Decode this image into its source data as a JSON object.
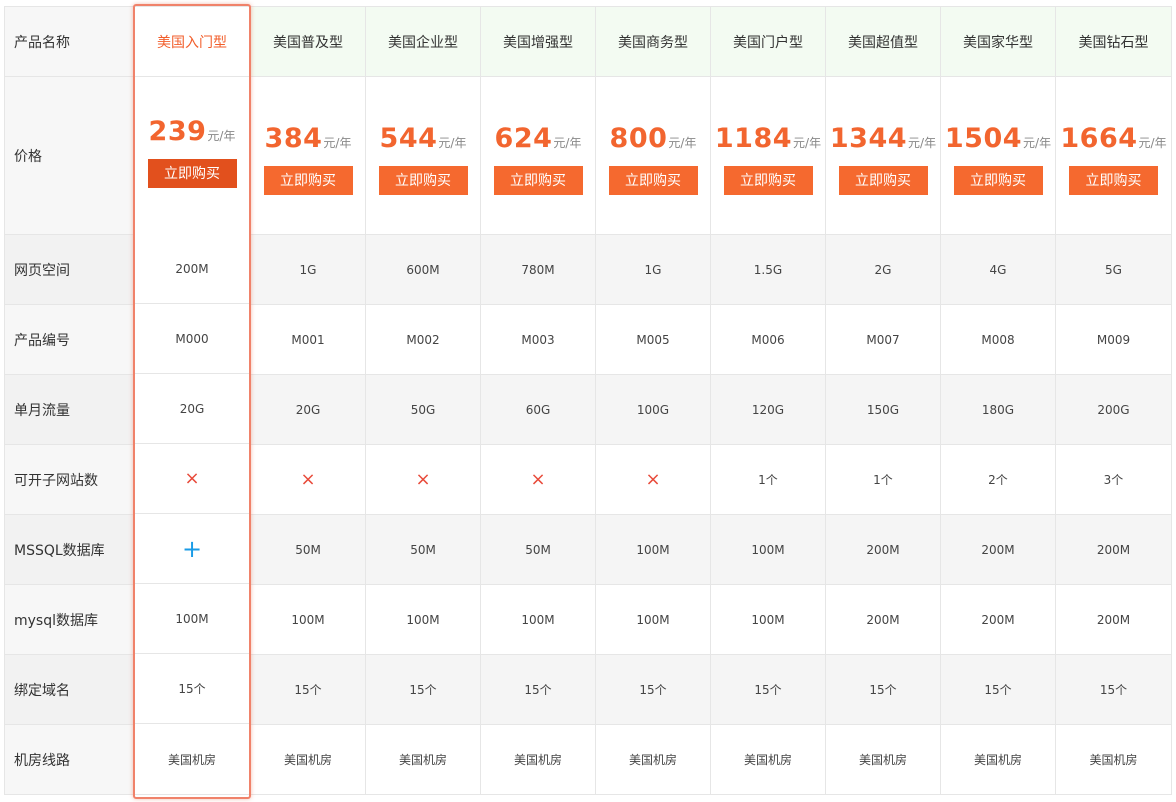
{
  "header": {
    "label": "产品名称",
    "plans": [
      "美国入门型",
      "美国普及型",
      "美国企业型",
      "美国增强型",
      "美国商务型",
      "美国门户型",
      "美国超值型",
      "美国家华型",
      "美国钻石型"
    ]
  },
  "price": {
    "label": "价格",
    "unit": "元/年",
    "buy_label": "立即购买",
    "values": [
      "239",
      "384",
      "544",
      "624",
      "800",
      "1184",
      "1344",
      "1504",
      "1664"
    ]
  },
  "rows": [
    {
      "label": "网页空间",
      "values": [
        "200M",
        "1G",
        "600M",
        "780M",
        "1G",
        "1.5G",
        "2G",
        "4G",
        "5G"
      ]
    },
    {
      "label": "产品编号",
      "values": [
        "M000",
        "M001",
        "M002",
        "M003",
        "M005",
        "M006",
        "M007",
        "M008",
        "M009"
      ]
    },
    {
      "label": "单月流量",
      "values": [
        "20G",
        "20G",
        "50G",
        "60G",
        "100G",
        "120G",
        "150G",
        "180G",
        "200G"
      ]
    },
    {
      "label": "可开子网站数",
      "values": [
        "×",
        "×",
        "×",
        "×",
        "×",
        "1个",
        "1个",
        "2个",
        "3个"
      ]
    },
    {
      "label": "MSSQL数据库",
      "values": [
        "+",
        "50M",
        "50M",
        "50M",
        "100M",
        "100M",
        "200M",
        "200M",
        "200M"
      ]
    },
    {
      "label": "mysql数据库",
      "values": [
        "100M",
        "100M",
        "100M",
        "100M",
        "100M",
        "100M",
        "200M",
        "200M",
        "200M"
      ]
    },
    {
      "label": "绑定域名",
      "values": [
        "15个",
        "15个",
        "15个",
        "15个",
        "15个",
        "15个",
        "15个",
        "15个",
        "15个"
      ]
    },
    {
      "label": "机房线路",
      "values": [
        "美国机房",
        "美国机房",
        "美国机房",
        "美国机房",
        "美国机房",
        "美国机房",
        "美国机房",
        "美国机房",
        "美国机房"
      ]
    }
  ],
  "colors": {
    "accent": "#f5692f",
    "price": "#f2652f",
    "highlight_border": "#f0826a",
    "cross": "#e84a3a",
    "plus": "#1a9be6",
    "header_bg": "#f3fbf2"
  }
}
